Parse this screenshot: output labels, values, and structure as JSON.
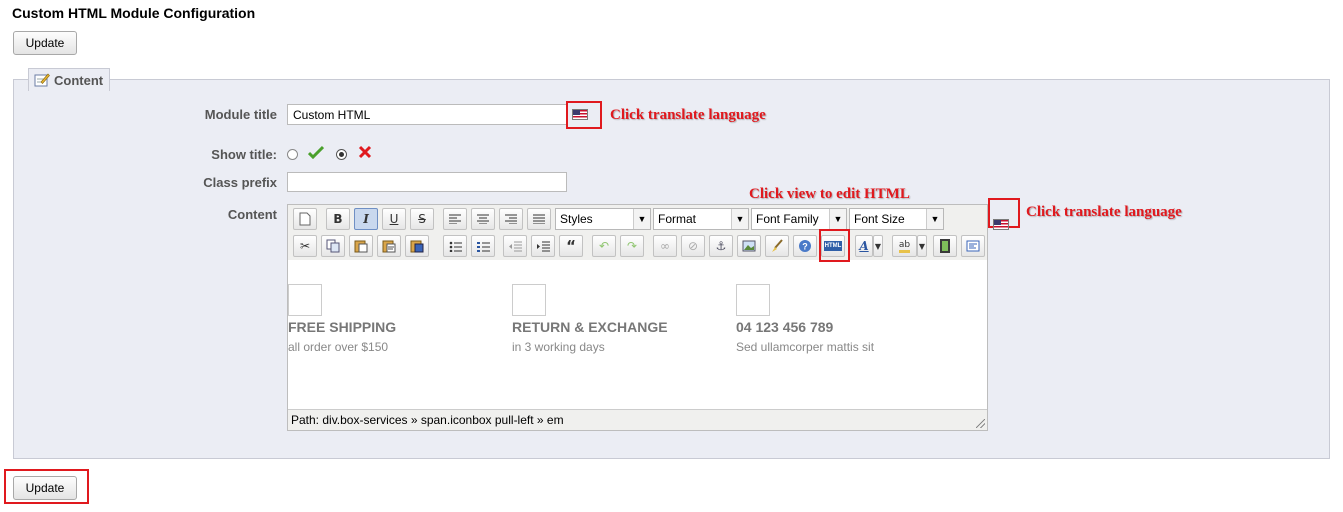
{
  "page": {
    "title": "Custom HTML Module Configuration"
  },
  "top_button": {
    "label": "Update"
  },
  "bottom_button": {
    "label": "Update"
  },
  "section": {
    "legend": "Content"
  },
  "form": {
    "module_title": {
      "label": "Module title",
      "value": "Custom HTML"
    },
    "show_title": {
      "label": "Show title:",
      "selected": "no"
    },
    "class_prefix": {
      "label": "Class prefix",
      "value": ""
    },
    "content": {
      "label": "Content"
    }
  },
  "annotations": {
    "translate_title": "Click translate language",
    "view_html": "Click view to edit HTML",
    "translate_content": "Click translate language"
  },
  "editor": {
    "dropdowns": {
      "styles": "Styles",
      "format": "Format",
      "font_family": "Font Family",
      "font_size": "Font Size"
    },
    "toolbar1": {
      "bold": "B",
      "italic": "I",
      "underline": "U",
      "strike": "S"
    },
    "html_button": "HTML",
    "services": [
      {
        "heading": "FREE SHIPPING",
        "sub": "all order over $150"
      },
      {
        "heading": "RETURN & EXCHANGE",
        "sub": "in 3 working days"
      },
      {
        "heading": "04 123 456 789",
        "sub": "Sed ullamcorper mattis sit"
      }
    ],
    "path": "Path: div.box-services » span.iconbox pull-left » em"
  },
  "colors": {
    "annotation_red": "#e0191e",
    "fieldset_bg": "#ebedf4"
  }
}
